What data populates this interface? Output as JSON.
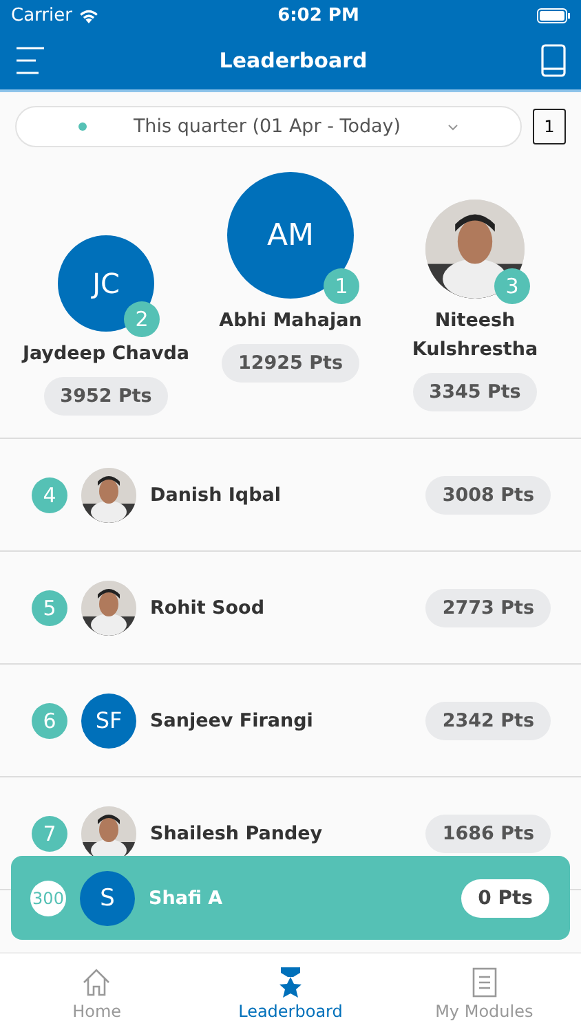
{
  "status_bar": {
    "carrier": "Carrier",
    "time": "6:02 PM"
  },
  "header": {
    "title": "Leaderboard"
  },
  "filter": {
    "label": "This quarter (01 Apr - Today)",
    "page": "1"
  },
  "podium": [
    {
      "rank": "2",
      "name": "Jaydeep Chavda",
      "points": "3952 Pts",
      "avatar": {
        "kind": "initials",
        "text": "JC"
      }
    },
    {
      "rank": "1",
      "name": "Abhi Mahajan",
      "points": "12925 Pts",
      "avatar": {
        "kind": "initials",
        "text": "AM"
      }
    },
    {
      "rank": "3",
      "name": "Niteesh Kulshrestha",
      "points": "3345 Pts"
    }
  ],
  "rows": [
    {
      "rank": "4",
      "name": "Danish Iqbal",
      "points": "3008 Pts"
    },
    {
      "rank": "5",
      "name": "Rohit Sood",
      "points": "2773 Pts"
    },
    {
      "rank": "6",
      "name": "Sanjeev Firangi",
      "points": "2342 Pts",
      "avatar": {
        "kind": "initials",
        "text": "SF"
      }
    },
    {
      "rank": "7",
      "name": "Shailesh Pandey",
      "points": "1686 Pts"
    }
  ],
  "current_user": {
    "rank": "300",
    "name": "Shafi A",
    "points": "0 Pts",
    "avatar": {
      "kind": "initials",
      "text": "S"
    }
  },
  "tabs": [
    {
      "label": "Home",
      "kind": "home",
      "selected": false
    },
    {
      "label": "Leaderboard",
      "kind": "award",
      "selected": true
    },
    {
      "label": "My Modules",
      "kind": "list",
      "selected": false
    }
  ]
}
